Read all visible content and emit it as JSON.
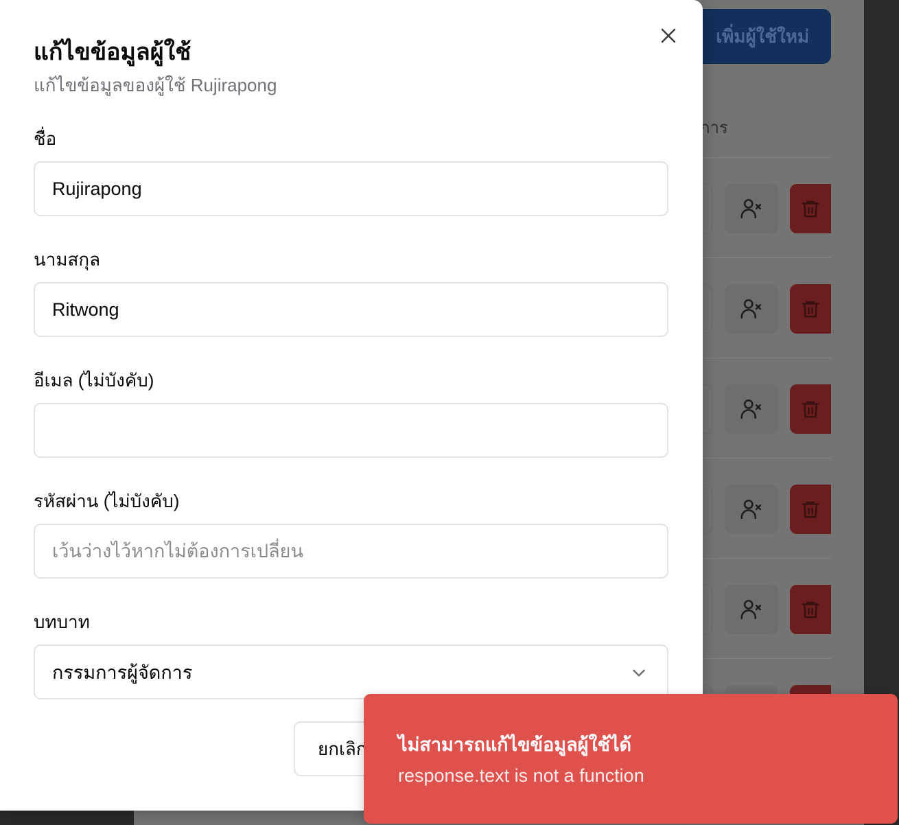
{
  "background": {
    "add_user_button": "เพิ่มผู้ใช้ใหม่",
    "column_header": "การ",
    "row_count": 6
  },
  "modal": {
    "title": "แก้ไขข้อมูลผู้ใช้",
    "subtitle": "แก้ไขข้อมูลของผู้ใช้ Rujirapong",
    "fields": {
      "first_name": {
        "label": "ชื่อ",
        "value": "Rujirapong"
      },
      "last_name": {
        "label": "นามสกุล",
        "value": "Ritwong"
      },
      "email": {
        "label": "อีเมล (ไม่บังคับ)",
        "value": ""
      },
      "password": {
        "label": "รหัสผ่าน (ไม่บังคับ)",
        "value": "",
        "placeholder": "เว้นว่างไว้หากไม่ต้องการเปลี่ยน"
      },
      "role": {
        "label": "บทบาท",
        "value": "กรรมการผู้จัดการ"
      }
    },
    "cancel_label": "ยกเลิก"
  },
  "toast": {
    "title": "ไม่สามารถแก้ไขข้อมูลผู้ใช้ได้",
    "description": "response.text is not a function"
  },
  "colors": {
    "toast_bg": "#df514d",
    "primary_dark": "#12305a",
    "delete_dark": "#6a1e1e"
  },
  "icons": {
    "close": "close-icon",
    "chevron": "chevron-down-icon",
    "deactivate": "user-x-icon",
    "delete": "trash-icon"
  }
}
